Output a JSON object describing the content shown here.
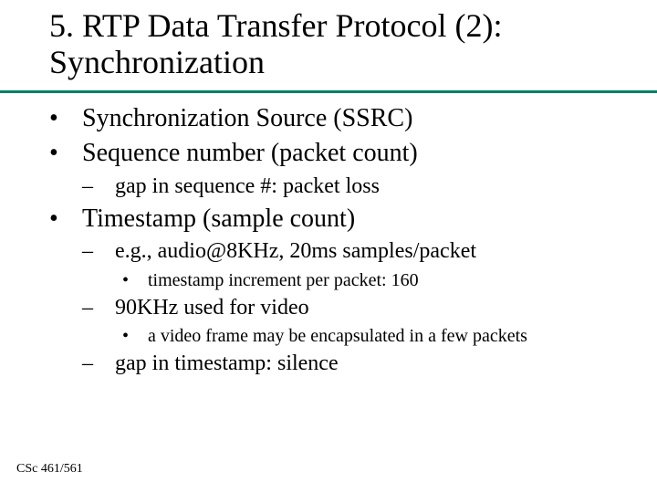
{
  "title": "5. RTP Data Transfer Protocol (2): Synchronization",
  "bullets": {
    "b1_1": "Synchronization Source (SSRC)",
    "b1_2": "Sequence number (packet count)",
    "b2_1": "gap in sequence #: packet loss",
    "b1_3": "Timestamp (sample count)",
    "b2_2": "e.g., audio@8KHz, 20ms samples/packet",
    "b3_1": "timestamp increment per packet: 160",
    "b2_3": "90KHz used for video",
    "b3_2": "a video frame may be encapsulated in a few packets",
    "b2_4": "gap in timestamp: silence"
  },
  "footer": "CSc 461/561",
  "glyphs": {
    "dot": "•",
    "dash": "–"
  }
}
